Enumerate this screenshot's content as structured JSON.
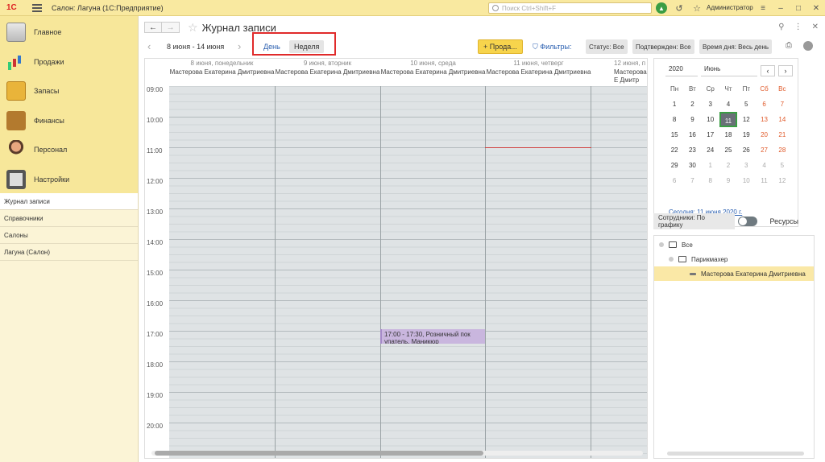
{
  "topbar": {
    "logo": "1С",
    "title": "Салон: Лагуна  (1С:Предприятие)",
    "search_placeholder": "Поиск Ctrl+Shift+F",
    "user": "Администратор"
  },
  "sidebar": {
    "sections": [
      {
        "label": "Главное",
        "icon": "clipboard-icon"
      },
      {
        "label": "Продажи",
        "icon": "bar-chart-icon"
      },
      {
        "label": "Запасы",
        "icon": "box-icon"
      },
      {
        "label": "Финансы",
        "icon": "wallet-icon"
      },
      {
        "label": "Персонал",
        "icon": "people-icon"
      },
      {
        "label": "Настройки",
        "icon": "gear-icon"
      }
    ],
    "links": [
      "Журнал записи",
      "Справочники",
      "Салоны",
      "Лагуна (Салон)"
    ]
  },
  "page": {
    "title": "Журнал записи",
    "period": "8 июня - 14 июня",
    "view_day": "День",
    "view_week": "Неделя",
    "sale_button": "+ Прода...",
    "filters_label": "Фильтры:",
    "status": "Статус: Все",
    "confirmed": "Подтвержден: Все",
    "time_of_day": "Время дня: Весь день"
  },
  "calendar": {
    "columns": [
      {
        "date": "8 июня, понедельник",
        "employee": "Мастерова Екатерина Дмитриевна"
      },
      {
        "date": "9 июня, вторник",
        "employee": "Мастерова Екатерина Дмитриевна"
      },
      {
        "date": "10 июня, среда",
        "employee": "Мастерова Екатерина Дмитриевна"
      },
      {
        "date": "11 июня, четверг",
        "employee": "Мастерова Екатерина Дмитриевна"
      },
      {
        "date": "12 июня, п",
        "employee": "Мастерова Е Дмитр"
      }
    ],
    "times": [
      "09:00",
      "10:00",
      "11:00",
      "12:00",
      "13:00",
      "14:00",
      "15:00",
      "16:00",
      "17:00",
      "18:00",
      "19:00",
      "20:00"
    ],
    "event": "17:00 - 17:30, Розничный пок упатель, Маникюр"
  },
  "mini_calendar": {
    "year": "2020",
    "month": "Июнь",
    "weekdays": [
      "Пн",
      "Вт",
      "Ср",
      "Чт",
      "Пт",
      "Сб",
      "Вс"
    ],
    "weeks": [
      [
        "1",
        "2",
        "3",
        "4",
        "5",
        "6",
        "7"
      ],
      [
        "8",
        "9",
        "10",
        "11",
        "12",
        "13",
        "14"
      ],
      [
        "15",
        "16",
        "17",
        "18",
        "19",
        "20",
        "21"
      ],
      [
        "22",
        "23",
        "24",
        "25",
        "26",
        "27",
        "28"
      ],
      [
        "29",
        "30",
        "1",
        "2",
        "3",
        "4",
        "5"
      ],
      [
        "6",
        "7",
        "8",
        "9",
        "10",
        "11",
        "12"
      ]
    ],
    "today_link": "Сегодня: 11 июня 2020 г."
  },
  "employees": {
    "schedule_toggle": "Сотрудники: По графику",
    "resources": "Ресурсы",
    "tree": [
      {
        "label": "Все",
        "level": 0,
        "type": "folder"
      },
      {
        "label": "Парикмахер",
        "level": 1,
        "type": "folder"
      },
      {
        "label": "Мастерова Екатерина Дмитриевна",
        "level": 2,
        "type": "item"
      }
    ]
  }
}
